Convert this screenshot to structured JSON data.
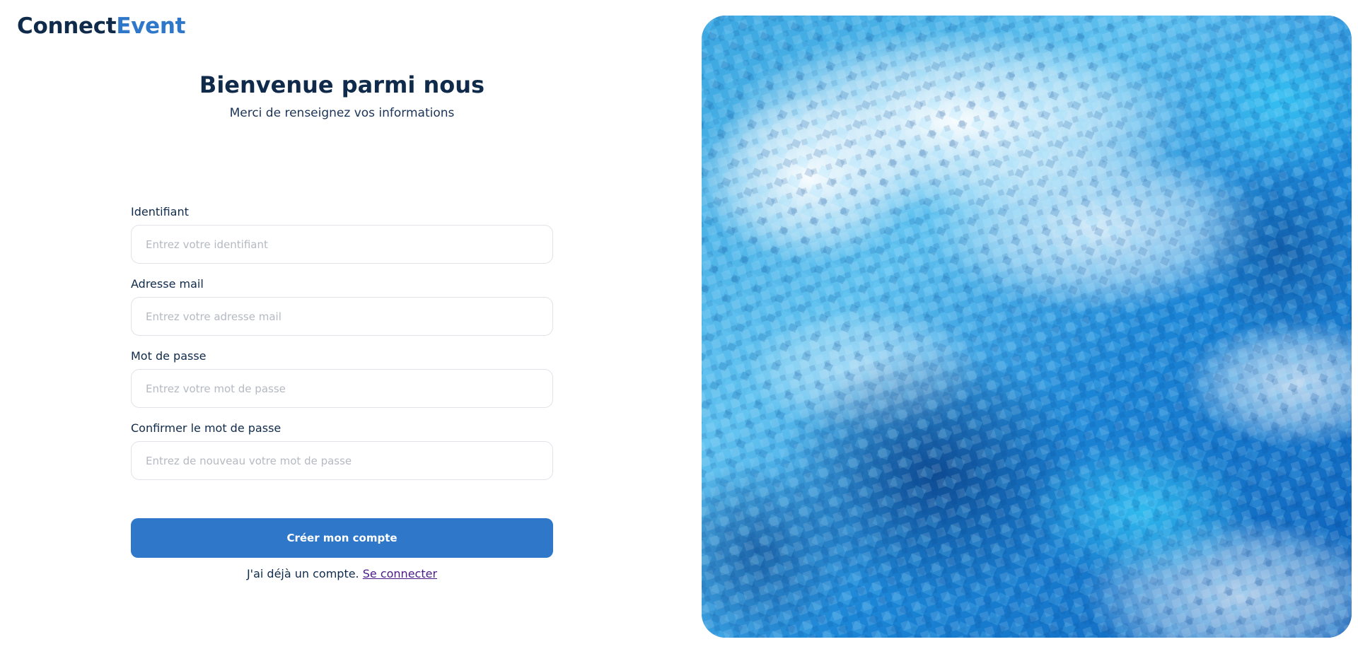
{
  "brand": {
    "part1": "Connect",
    "part2": "Event"
  },
  "header": {
    "title": "Bienvenue parmi nous",
    "subtitle": "Merci de renseignez vos informations"
  },
  "form": {
    "fields": [
      {
        "label": "Identifiant",
        "placeholder": "Entrez votre identifiant",
        "value": ""
      },
      {
        "label": "Adresse mail",
        "placeholder": "Entrez votre adresse mail",
        "value": ""
      },
      {
        "label": "Mot de passe",
        "placeholder": "Entrez votre mot de passe",
        "value": ""
      },
      {
        "label": "Confirmer le mot de passe",
        "placeholder": "Entrez de nouveau votre mot de passe",
        "value": ""
      }
    ],
    "submit_label": "Créer mon compte"
  },
  "footer": {
    "prompt": "J'ai déjà un compte.",
    "link_label": "Se connecter"
  },
  "colors": {
    "primary": "#2e77c9",
    "navy": "#0f2a4a",
    "link": "#4a1a86"
  }
}
